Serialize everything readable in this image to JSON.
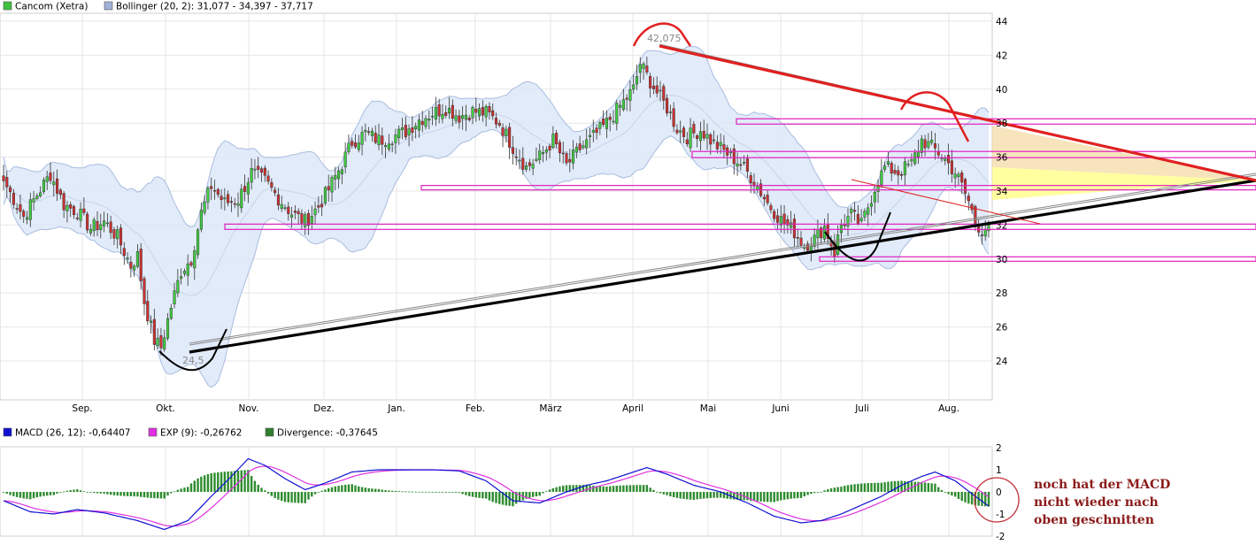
{
  "legend_main": [
    {
      "swatch": "#3fbf3f",
      "text": "Cancom (Xetra)"
    },
    {
      "swatch": "#9fb0d8",
      "text": "Bollinger (20, 2): 31,077 - 34,397 - 37,717"
    }
  ],
  "legend_macd": [
    {
      "swatch": "#1010d0",
      "text": "MACD (26, 12): -0,64407"
    },
    {
      "swatch": "#e030e0",
      "text": "EXP (9): -0,26762"
    },
    {
      "swatch": "#2f7f2f",
      "text": "Divergence: -0,37645"
    }
  ],
  "annotation_lines": [
    "noch hat der MACD",
    "nicht wieder nach",
    "oben geschnitten"
  ],
  "price_labels": {
    "high": "42,075",
    "low": "24,5"
  },
  "colors": {
    "up": "#3fcf3f",
    "down": "#d03030",
    "band": "#dde8f8",
    "band_line": "#a8bce0",
    "grid": "#e6e6e6",
    "magenta": "#e020c0",
    "red_trend": "#e02020",
    "macd": "#1010d0",
    "signal": "#e030e0",
    "hist": "#2e8b2e"
  },
  "chart_data": [
    {
      "type": "candlestick",
      "title": "Cancom (Xetra)",
      "x_tick_labels": [
        "Sep.",
        "Okt.",
        "Nov.",
        "Dez.",
        "Jan.",
        "Feb.",
        "März",
        "April",
        "Mai",
        "Juni",
        "Juli",
        "Aug."
      ],
      "y_ticks": [
        24,
        26,
        28,
        30,
        32,
        34,
        36,
        38,
        40,
        42,
        44
      ],
      "ylim": [
        22.5,
        44.5
      ],
      "grid": true,
      "close_anchors": [
        [
          0,
          34.6
        ],
        [
          6,
          32.5
        ],
        [
          10,
          33.8
        ],
        [
          14,
          35.0
        ],
        [
          18,
          33.2
        ],
        [
          22,
          32.8
        ],
        [
          26,
          31.8
        ],
        [
          30,
          32.2
        ],
        [
          34,
          31.3
        ],
        [
          38,
          29.6
        ],
        [
          40,
          30.2
        ],
        [
          42,
          27.5
        ],
        [
          45,
          25.2
        ],
        [
          47,
          24.8
        ],
        [
          50,
          27.2
        ],
        [
          53,
          29.3
        ],
        [
          56,
          30.0
        ],
        [
          59,
          32.7
        ],
        [
          62,
          34.3
        ],
        [
          66,
          33.3
        ],
        [
          70,
          33.5
        ],
        [
          74,
          35.1
        ],
        [
          78,
          34.6
        ],
        [
          82,
          33.6
        ],
        [
          86,
          32.7
        ],
        [
          90,
          32.2
        ],
        [
          94,
          33.1
        ],
        [
          97,
          34.1
        ],
        [
          101,
          35.6
        ],
        [
          104,
          36.9
        ],
        [
          108,
          37.4
        ],
        [
          112,
          37.0
        ],
        [
          116,
          37.2
        ],
        [
          120,
          37.5
        ],
        [
          124,
          38.2
        ],
        [
          128,
          38.6
        ],
        [
          132,
          38.9
        ],
        [
          136,
          38.4
        ],
        [
          140,
          38.7
        ],
        [
          144,
          38.6
        ],
        [
          148,
          38.0
        ],
        [
          152,
          36.6
        ],
        [
          156,
          35.4
        ],
        [
          160,
          36.0
        ],
        [
          164,
          37.0
        ],
        [
          168,
          35.5
        ],
        [
          172,
          36.5
        ],
        [
          176,
          37.2
        ],
        [
          180,
          38.0
        ],
        [
          184,
          39.0
        ],
        [
          188,
          40.0
        ],
        [
          190,
          41.5
        ],
        [
          192,
          40.8
        ],
        [
          195,
          39.8
        ],
        [
          198,
          38.9
        ],
        [
          201,
          37.7
        ],
        [
          204,
          37.2
        ],
        [
          208,
          37.6
        ],
        [
          212,
          36.8
        ],
        [
          216,
          36.2
        ],
        [
          220,
          35.6
        ],
        [
          224,
          34.6
        ],
        [
          228,
          33.3
        ],
        [
          232,
          32.3
        ],
        [
          236,
          31.6
        ],
        [
          239,
          30.8
        ],
        [
          242,
          31.2
        ],
        [
          245,
          31.9
        ],
        [
          248,
          30.4
        ],
        [
          250,
          32.0
        ],
        [
          253,
          32.6
        ],
        [
          256,
          32.0
        ],
        [
          260,
          34.2
        ],
        [
          263,
          35.4
        ],
        [
          267,
          35.1
        ],
        [
          271,
          35.6
        ],
        [
          274,
          37.0
        ],
        [
          277,
          36.6
        ],
        [
          280,
          36.1
        ],
        [
          284,
          35.1
        ],
        [
          286,
          34.3
        ],
        [
          288,
          33.4
        ],
        [
          290,
          32.2
        ],
        [
          292,
          31.7
        ],
        [
          294,
          32.0
        ]
      ],
      "bollinger": {
        "upper": 37.717,
        "middle": 34.397,
        "lower": 31.077
      },
      "annotations": {
        "high": 42.075,
        "low": 24.5
      }
    },
    {
      "type": "line",
      "title": "MACD (26, 12)",
      "series": [
        {
          "name": "MACD (26, 12)",
          "last": -0.64407
        },
        {
          "name": "EXP (9)",
          "last": -0.26762
        },
        {
          "name": "Divergence",
          "last": -0.37645,
          "type": "bar"
        }
      ],
      "macd_anchors": [
        [
          0,
          -0.4
        ],
        [
          8,
          -0.9
        ],
        [
          15,
          -1.0
        ],
        [
          22,
          -0.8
        ],
        [
          30,
          -0.95
        ],
        [
          40,
          -1.3
        ],
        [
          48,
          -1.7
        ],
        [
          55,
          -1.3
        ],
        [
          62,
          -0.2
        ],
        [
          68,
          0.7
        ],
        [
          73,
          1.5
        ],
        [
          78,
          1.2
        ],
        [
          84,
          0.6
        ],
        [
          90,
          0.1
        ],
        [
          96,
          0.4
        ],
        [
          104,
          0.9
        ],
        [
          112,
          1.0
        ],
        [
          120,
          1.0
        ],
        [
          128,
          1.0
        ],
        [
          136,
          0.95
        ],
        [
          144,
          0.5
        ],
        [
          152,
          -0.4
        ],
        [
          160,
          -0.5
        ],
        [
          168,
          0.0
        ],
        [
          174,
          0.3
        ],
        [
          180,
          0.5
        ],
        [
          188,
          0.9
        ],
        [
          192,
          1.1
        ],
        [
          198,
          0.8
        ],
        [
          206,
          0.3
        ],
        [
          214,
          0.0
        ],
        [
          222,
          -0.5
        ],
        [
          230,
          -1.1
        ],
        [
          238,
          -1.4
        ],
        [
          244,
          -1.3
        ],
        [
          250,
          -1.0
        ],
        [
          256,
          -0.6
        ],
        [
          262,
          -0.2
        ],
        [
          268,
          0.3
        ],
        [
          274,
          0.7
        ],
        [
          278,
          0.9
        ],
        [
          284,
          0.5
        ],
        [
          290,
          -0.2
        ],
        [
          294,
          -0.64
        ]
      ],
      "ylim": [
        -2,
        2
      ],
      "y_ticks": [
        -2,
        -1,
        0,
        1,
        2
      ]
    }
  ]
}
